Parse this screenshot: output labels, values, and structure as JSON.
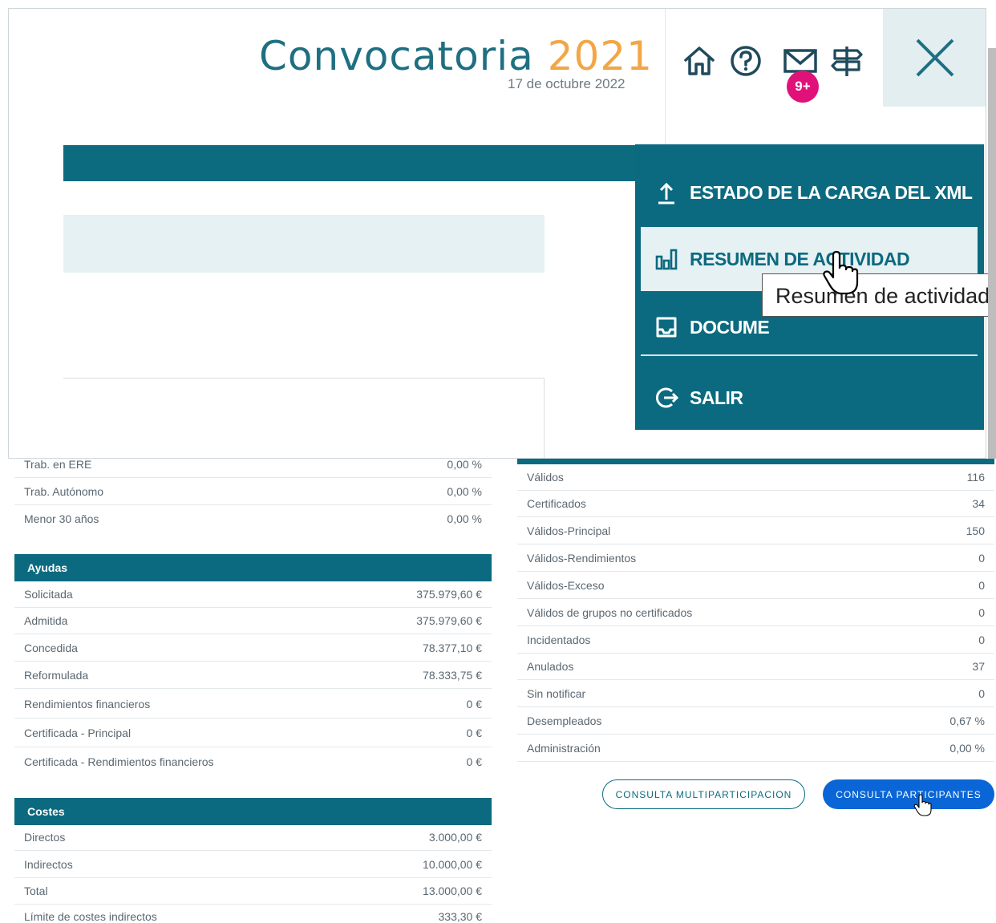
{
  "header": {
    "title_word": "Convocatoria",
    "title_year": "2021",
    "date": "17 de octubre 2022",
    "mail_badge": "9+",
    "icons": [
      "home-icon",
      "help-icon",
      "mail-icon",
      "signpost-icon",
      "close-icon"
    ]
  },
  "menu": {
    "items": [
      {
        "label": "ESTADO DE LA CARGA DEL XML",
        "icon": "upload-icon"
      },
      {
        "label": "RESUMEN DE ACTIVIDAD",
        "icon": "bar-chart-icon"
      },
      {
        "label": "DOCUME",
        "icon": "tray-icon"
      },
      {
        "label": "SALIR",
        "icon": "logout-icon"
      }
    ],
    "tooltip": "Resumen de actividad"
  },
  "left_panel": {
    "top_rows": [
      {
        "label": "Trab. en ERE",
        "value": "0,00 %"
      },
      {
        "label": "Trab. Autónomo",
        "value": "0,00 %"
      },
      {
        "label": "Menor 30 años",
        "value": "0,00 %"
      }
    ],
    "ayudas": {
      "title": "Ayudas",
      "rows": [
        {
          "label": "Solicitada",
          "value": "375.979,60 €"
        },
        {
          "label": "Admitida",
          "value": "375.979,60 €"
        },
        {
          "label": "Concedida",
          "value": "78.377,10 €"
        },
        {
          "label": "Reformulada",
          "value": "78.333,75 €"
        },
        {
          "label": "Rendimientos financieros",
          "value": "0 €"
        },
        {
          "label": "Certificada - Principal",
          "value": "0 €"
        },
        {
          "label": "Certificada - Rendimientos financieros",
          "value": "0 €"
        }
      ]
    },
    "costes": {
      "title": "Costes",
      "rows": [
        {
          "label": "Directos",
          "value": "3.000,00 €"
        },
        {
          "label": "Indirectos",
          "value": "10.000,00 €"
        },
        {
          "label": "Total",
          "value": "13.000,00 €"
        },
        {
          "label": "Límite de costes indirectos",
          "value": "333,30 €"
        }
      ]
    }
  },
  "right_panel": {
    "rows": [
      {
        "label": "Válidos",
        "value": "116"
      },
      {
        "label": "Certificados",
        "value": "34"
      },
      {
        "label": "Válidos-Principal",
        "value": "150"
      },
      {
        "label": "Válidos-Rendimientos",
        "value": "0"
      },
      {
        "label": "Válidos-Exceso",
        "value": "0"
      },
      {
        "label": "Válidos de grupos no certificados",
        "value": "0"
      },
      {
        "label": "Incidentados",
        "value": "0"
      },
      {
        "label": "Anulados",
        "value": "37"
      },
      {
        "label": "Sin notificar",
        "value": "0"
      },
      {
        "label": "Desempleados",
        "value": "0,67 %"
      },
      {
        "label": "Administración",
        "value": "0,00 %"
      }
    ],
    "buttons": {
      "multi": "CONSULTA MULTIPARTICIPACION",
      "participantes": "CONSULTA PARTICIPANTES"
    }
  },
  "colors": {
    "teal": "#0b6a7f",
    "accent_year": "#f3a646",
    "badge": "#e0127a",
    "primary_button": "#0a66d6"
  }
}
